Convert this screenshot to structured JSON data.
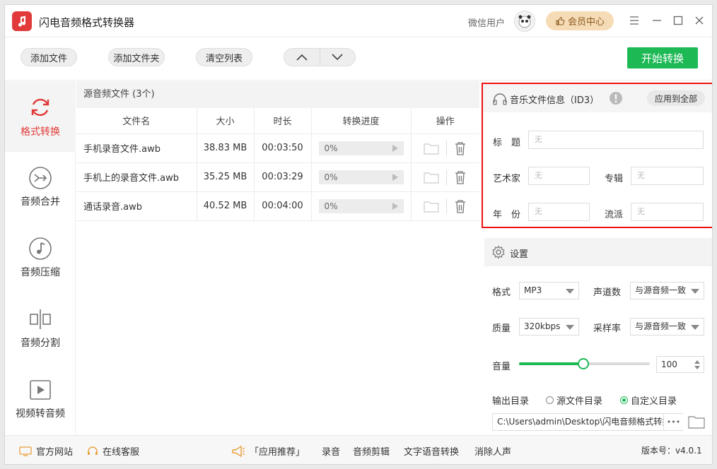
{
  "app": {
    "title": "闪电音频格式转换器",
    "user_name": "微信用户",
    "vip_label": "会员中心"
  },
  "toolbar": {
    "add_file": "添加文件",
    "add_folder": "添加文件夹",
    "clear_list": "清空列表",
    "start_convert": "开始转换"
  },
  "sidebar": {
    "items": [
      {
        "label": "格式转换",
        "icon": "refresh-icon",
        "active": true
      },
      {
        "label": "音频合并",
        "icon": "merge-icon",
        "active": false
      },
      {
        "label": "音频压缩",
        "icon": "music-note-icon",
        "active": false
      },
      {
        "label": "音频分割",
        "icon": "split-icon",
        "active": false
      },
      {
        "label": "视频转音频",
        "icon": "video-icon",
        "active": false
      }
    ]
  },
  "file_list": {
    "header": "源音频文件 (3个)",
    "columns": [
      "文件名",
      "大小",
      "时长",
      "转换进度",
      "操作"
    ],
    "rows": [
      {
        "name": "手机录音文件.awb",
        "size": "38.83 MB",
        "duration": "00:03:50",
        "progress": "0%"
      },
      {
        "name": "手机上的录音文件.awb",
        "size": "35.25 MB",
        "duration": "00:03:29",
        "progress": "0%"
      },
      {
        "name": "通话录音.awb",
        "size": "40.52 MB",
        "duration": "00:04:00",
        "progress": "0%"
      }
    ]
  },
  "id3": {
    "title": "音乐文件信息（ID3）",
    "apply_all": "应用到全部",
    "labels": {
      "song_title": "标　题",
      "artist": "艺术家",
      "album": "专辑",
      "year": "年　份",
      "genre": "流派"
    },
    "placeholder": "无"
  },
  "settings": {
    "title": "设置",
    "format_label": "格式",
    "format_value": "MP3",
    "channels_label": "声道数",
    "channels_value": "与源音频一致",
    "quality_label": "质量",
    "quality_value": "320kbps",
    "samplerate_label": "采样率",
    "samplerate_value": "与源音频一致",
    "volume_label": "音量",
    "volume_value": "100",
    "volume_fraction": 0.49,
    "output_label": "输出目录",
    "output_source": "源文件目录",
    "output_custom": "自定义目录",
    "output_path": "C:\\Users\\admin\\Desktop\\闪电音频格式转换器",
    "more": "•••"
  },
  "statusbar": {
    "website": "官方网站",
    "support": "在线客服",
    "recommend": "「应用推荐」",
    "record": "录音",
    "audio_edit": "音频剪辑",
    "tts": "文字语音转换",
    "vocal_remove": "消除人声",
    "version": "版本号：v4.0.1"
  },
  "colors": {
    "accent": "#1db955",
    "brand": "#e23a3a",
    "highlight_border": "#e11111"
  }
}
